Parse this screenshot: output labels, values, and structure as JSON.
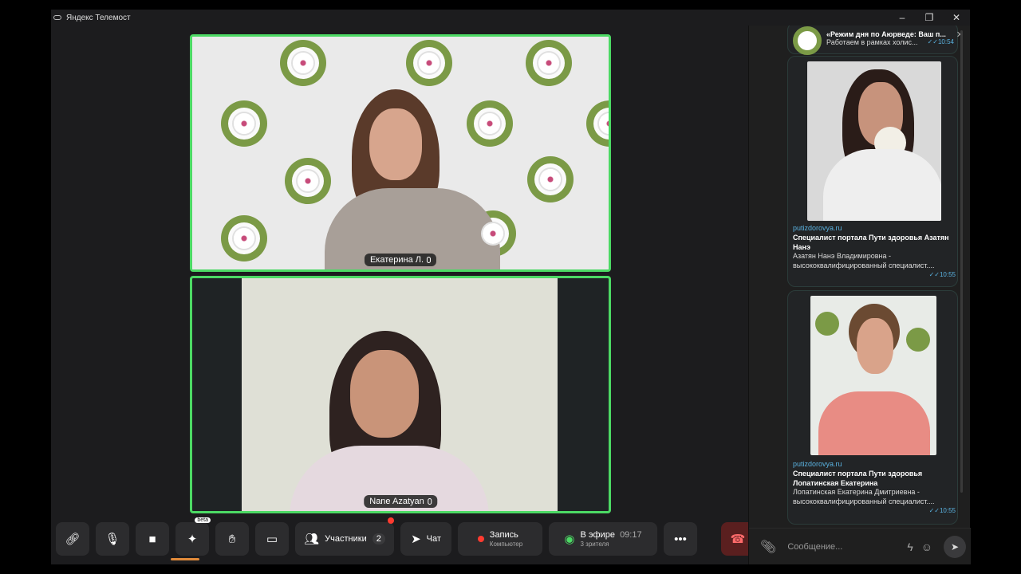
{
  "titlebar": {
    "app_title": "Яндекс Телемост",
    "minimize": "–",
    "maximize": "❐",
    "close": "✕"
  },
  "participants": [
    {
      "name": "Екатерина Л."
    },
    {
      "name": "Nane Azatyan"
    }
  ],
  "toolbar": {
    "participants_label": "Участники",
    "participants_count": "2",
    "chat_label": "Чат",
    "record_label": "Запись",
    "record_sub": "Компьютер",
    "live_label": "В эфире",
    "live_time": "09:17",
    "live_sub": "3 зрителя",
    "beta_badge": "beta",
    "more": "•••"
  },
  "chat": {
    "top_message": {
      "title": "«Режим дня по Аюрведе: Ваш п...",
      "text": "Работаем в рамках холис...",
      "time": "✓✓10:54"
    },
    "messages": [
      {
        "link": "putizdorovya.ru",
        "title": "Специалист портала Пути здоровья Азатян Нанэ",
        "text": "Азатян Нанэ Владимировна - высококвалифицированный специалист....",
        "time": "✓✓10:55"
      },
      {
        "link": "putizdorovya.ru",
        "title": "Специалист портала Пути здоровья Лопатинская Екатерина",
        "text": "Лопатинская Екатерина Дмитриевна - высококвалифицированный специалист....",
        "time": "✓✓10:55"
      }
    ],
    "input_placeholder": "Сообщение..."
  },
  "colors": {
    "active_speaker_border": "#4cd964",
    "record_dot": "#ff3b30",
    "hangup": "#5a1f1f",
    "link": "#5ab2e0"
  }
}
